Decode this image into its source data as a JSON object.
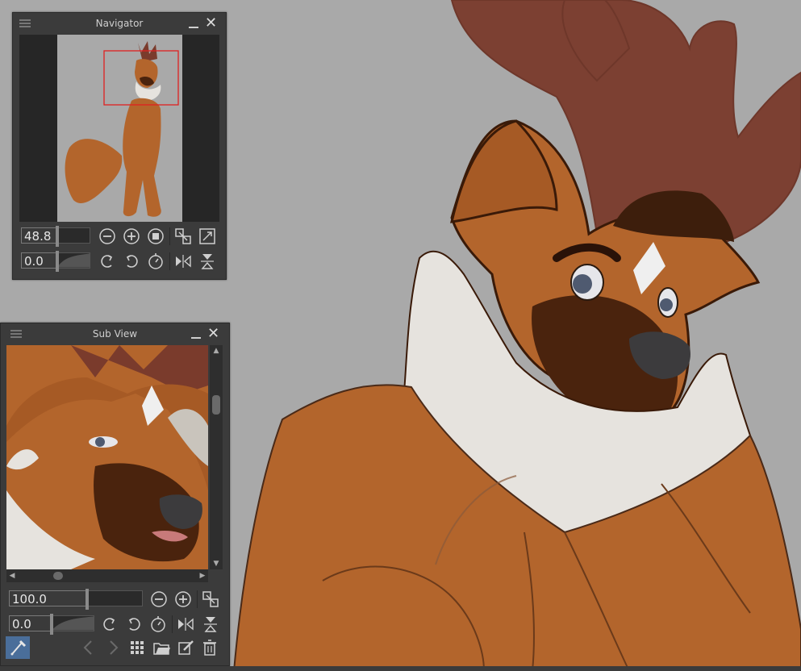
{
  "navigator": {
    "title": "Navigator",
    "zoom_value": "48.8",
    "rotation_value": "0.0"
  },
  "subview": {
    "title": "Sub View",
    "zoom_value": "100.0",
    "rotation_value": "0.0"
  },
  "colors": {
    "panel_bg": "#3b3b3b",
    "canvas_bg": "#a9a9a9",
    "fur_orange": "#b3652c",
    "fur_dark": "#4a230d",
    "antler": "#7a3b2c",
    "chest_white": "#e6e3de",
    "view_frame": "#e02020"
  }
}
